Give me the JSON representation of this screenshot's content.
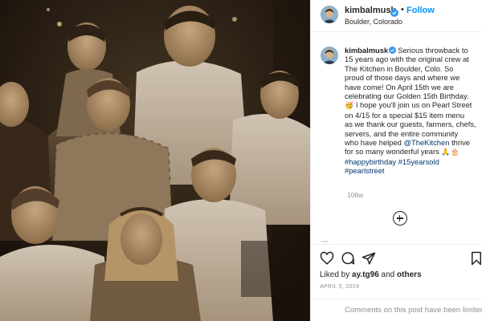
{
  "header": {
    "username": "kimbalmusk",
    "follow_label": "Follow",
    "separator": "•",
    "location": "Boulder, Colorado"
  },
  "caption": {
    "username": "kimbalmusk",
    "lines": [
      "Serious throwback to",
      "15 years ago with the original crew at",
      "The Kitchen in Boulder, Colo. So",
      "proud of those days and where we",
      "have come! On April 15th we are",
      "celebrating our Golden 15th Birthday.",
      "I hope you'll join us on Pearl Street",
      "on 4/15 for a special $15 item menu",
      "as we thank our guests, farmers, chefs,",
      "servers, and the entire community",
      "who have helped",
      "thrive",
      "for so many wonderful years",
      "#happybirthday #15yearsold",
      "#pearlstreet"
    ],
    "mention": "@TheKitchen",
    "emoji_party": "🥳",
    "emoji_pray": "🙏",
    "emoji_cake": "🎂",
    "time_ago": "106w"
  },
  "actions": {
    "liked_prefix": "Liked by",
    "liked_user": "ay.tg96",
    "liked_and": "and",
    "liked_others": "others",
    "date": "APRIL 5, 2019",
    "comments_limited": "Comments on this post have been limited."
  },
  "icons": {
    "verified": "verified-badge-icon",
    "like": "heart-icon",
    "comment": "comment-icon",
    "share": "paper-plane-icon",
    "save": "bookmark-icon",
    "load_more": "plus-circle-icon"
  },
  "colors": {
    "link_blue": "#0095f6",
    "hashtag": "#00376b",
    "muted": "#8e8e8e",
    "text": "#262626"
  }
}
